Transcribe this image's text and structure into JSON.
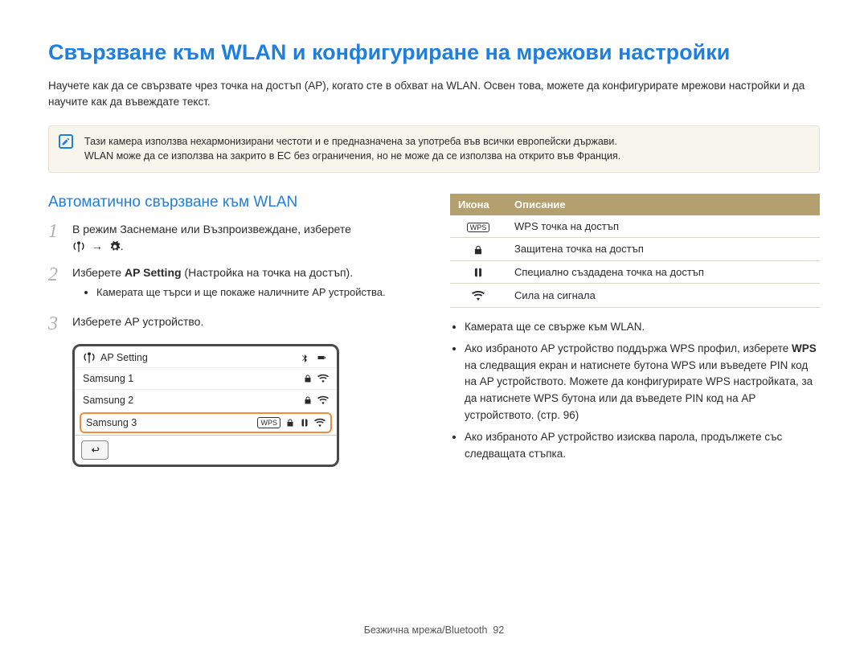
{
  "title": "Свързване към WLAN и конфигуриране на мрежови настройки",
  "intro": "Научете как да се свързвате чрез точка на достъп (AP), когато сте в обхват на WLAN. Освен това, можете да конфигурирате мрежови настройки и да научите как да въвеждате текст.",
  "note": {
    "line1": "Тази камера използва нехармонизирани честоти и е предназначена за употреба във всички европейски държави.",
    "line2": "WLAN може да се използва на закрито в ЕС без ограничения, но не може да се използва на открито във Франция."
  },
  "section_heading": "Автоматично свързване към WLAN",
  "steps": {
    "s1": {
      "num": "1",
      "text_a": "В режим Заснемане или Възпроизвеждане, изберете",
      "text_b": " → ",
      "text_c": "."
    },
    "s2": {
      "num": "2",
      "text_a": "Изберете ",
      "bold": "AP Setting",
      "text_b": " (Настройка на точка на достъп).",
      "bullet": "Камерата ще търси и ще покаже наличните AP устройства."
    },
    "s3": {
      "num": "3",
      "text": "Изберете AP устройство."
    }
  },
  "device": {
    "header_label": "AP Setting",
    "rows": [
      {
        "name": "Samsung 1",
        "wps": false,
        "locked": true,
        "special": false
      },
      {
        "name": "Samsung 2",
        "wps": false,
        "locked": true,
        "special": false
      },
      {
        "name": "Samsung 3",
        "wps": true,
        "locked": true,
        "special": true,
        "selected": true
      }
    ]
  },
  "table": {
    "header_icon": "Икона",
    "header_desc": "Описание",
    "rows": [
      {
        "icon": "WPS",
        "desc": "WPS точка на достъп"
      },
      {
        "icon": "lock",
        "desc": "Защитена точка на достъп"
      },
      {
        "icon": "special",
        "desc": "Специално създадена точка на достъп"
      },
      {
        "icon": "wifi",
        "desc": "Сила на сигнала"
      }
    ]
  },
  "right_bullets": {
    "b1": "Камерата ще се свърже към WLAN.",
    "b2_a": "Ако избраното AP устройство поддържа WPS профил, изберете ",
    "b2_bold": "WPS",
    "b2_b": " на следващия екран и натиснете бутона WPS или въведете PIN код на AP устройството. Можете да конфигурирате WPS настройката, за да натиснете WPS бутона или да въведете PIN код на AP устройството. (стр. 96)",
    "b3": "Ако избраното AP устройство изисква парола, продължете със следващата стъпка."
  },
  "footer": {
    "section": "Безжична мрежа/Bluetooth",
    "page": "92"
  }
}
